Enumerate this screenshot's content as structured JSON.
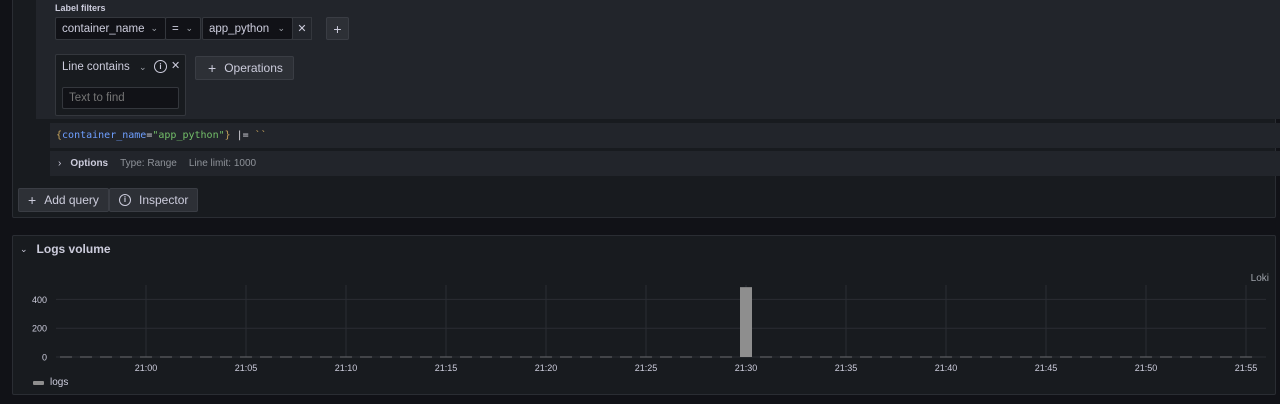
{
  "query_builder": {
    "label_filters_title": "Label filters",
    "filter": {
      "label": "container_name",
      "operator": "=",
      "value": "app_python"
    },
    "operation": {
      "name": "Line contains",
      "placeholder": "Text to find"
    },
    "operations_button": "Operations"
  },
  "raw_query": {
    "open_brace": "{",
    "key": "container_name",
    "eq": "=",
    "value": "\"app_python\"",
    "close_brace": "}",
    "pipe": " |= ",
    "backticks": "``"
  },
  "options": {
    "title": "Options",
    "type": "Type: Range",
    "line_limit": "Line limit: 1000"
  },
  "actions": {
    "add_query": "Add query",
    "inspector": "Inspector"
  },
  "logs_volume": {
    "title": "Logs volume",
    "datasource": "Loki",
    "legend": "logs"
  },
  "chart_data": {
    "type": "bar",
    "title": "",
    "xlabel": "",
    "ylabel": "",
    "y_ticks": [
      0,
      200,
      400
    ],
    "ylim": [
      0,
      500
    ],
    "x_ticks": [
      "21:00",
      "21:05",
      "21:10",
      "21:15",
      "21:20",
      "21:25",
      "21:30",
      "21:35",
      "21:40",
      "21:45",
      "21:50",
      "21:55"
    ],
    "series": [
      {
        "name": "logs",
        "color": "#8e8e8e",
        "bars": [
          {
            "time": "21:30",
            "value": 485
          }
        ]
      }
    ],
    "grid": true
  },
  "colors": {
    "background": "#111217",
    "panel": "#181b1f",
    "code_key": "#6e9fff",
    "code_string": "#73bf69",
    "code_brace": "#c6a35c"
  }
}
